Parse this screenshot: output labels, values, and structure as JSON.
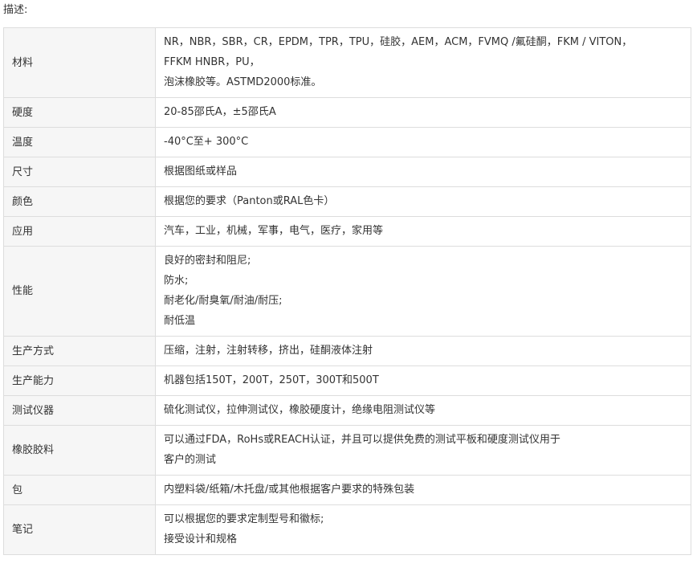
{
  "description_label": "描述:",
  "rows": [
    {
      "label": "材料",
      "lines": [
        "NR，NBR，SBR，CR，EPDM，TPR，TPU，硅胶，AEM，ACM，FVMQ /氟硅酮，FKM / VITON，",
        "FFKM HNBR，PU，",
        "泡沫橡胶等。ASTMD2000标准。"
      ]
    },
    {
      "label": "硬度",
      "lines": [
        "20-85邵氏A，±5邵氏A"
      ]
    },
    {
      "label": "温度",
      "lines": [
        "-40°C至+ 300°C"
      ]
    },
    {
      "label": "尺寸",
      "lines": [
        "根据图纸或样品"
      ]
    },
    {
      "label": "颜色",
      "lines": [
        "根据您的要求（Panton或RAL色卡）"
      ]
    },
    {
      "label": "应用",
      "lines": [
        "汽车，工业，机械，军事，电气，医疗，家用等"
      ]
    },
    {
      "label": "性能",
      "lines": [
        "良好的密封和阻尼;",
        "防水;",
        "耐老化/耐臭氧/耐油/耐压;",
        "耐低温"
      ]
    },
    {
      "label": "生产方式",
      "lines": [
        "压缩，注射，注射转移，挤出，硅酮液体注射"
      ]
    },
    {
      "label": "生产能力",
      "lines": [
        "机器包括150T，200T，250T，300T和500T"
      ]
    },
    {
      "label": "测试仪器",
      "lines": [
        "硫化测试仪，拉伸测试仪，橡胶硬度计，绝缘电阻测试仪等"
      ]
    },
    {
      "label": "橡胶胶料",
      "lines": [
        "可以通过FDA，RoHs或REACH认证，并且可以提供免费的测试平板和硬度测试仪用于",
        "客户的测试"
      ]
    },
    {
      "label": "包",
      "lines": [
        "内塑料袋/纸箱/木托盘/或其他根据客户要求的特殊包装"
      ]
    },
    {
      "label": "笔记",
      "lines": [
        "可以根据您的要求定制型号和徽标;",
        "接受设计和规格"
      ]
    }
  ]
}
